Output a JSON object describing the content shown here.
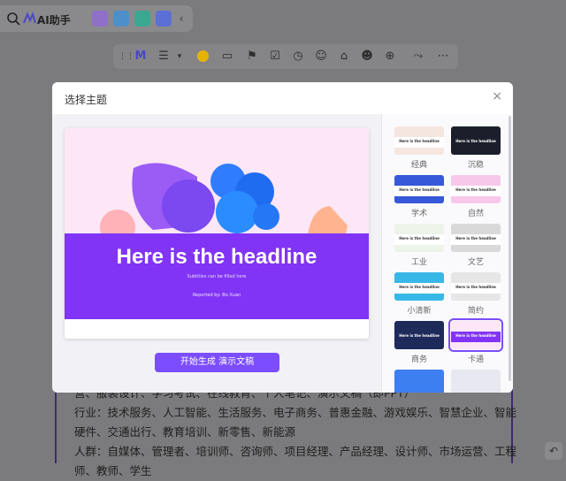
{
  "topbar": {
    "ai_label": "AI助手"
  },
  "modal": {
    "title": "选择主题",
    "close": "×",
    "preview": {
      "headline": "Here is the headline",
      "subtitle": "Subtitles can be filled here",
      "reporter": "Reported by:  Bo Xuan"
    },
    "generate_button": "开始生成 演示文稿",
    "themes": [
      {
        "label": "经典",
        "thumb_text": "Here is the headline",
        "bg": "#f5e6e0",
        "band": "#ffffff",
        "color": "#333333"
      },
      {
        "label": "沉稳",
        "thumb_text": "Here is the headline",
        "bg": "#1c1f2b",
        "band": "#1c1f2b",
        "color": "#ffffff"
      },
      {
        "label": "学术",
        "thumb_text": "Here is the headline",
        "bg": "#3658d9",
        "band": "#ffffff",
        "color": "#333333"
      },
      {
        "label": "自然",
        "thumb_text": "Here is the headline",
        "bg": "#f7c8ea",
        "band": "#ffffff",
        "color": "#333333"
      },
      {
        "label": "工业",
        "thumb_text": "Here is the headline",
        "bg": "#eef3ea",
        "band": "#ffffff",
        "color": "#333333"
      },
      {
        "label": "文艺",
        "thumb_text": "Here is the headline",
        "bg": "#d9d9d9",
        "band": "#ffffff",
        "color": "#333333"
      },
      {
        "label": "小清新",
        "thumb_text": "Here is the headline",
        "bg": "#38b8e6",
        "band": "#ffffff",
        "color": "#333333"
      },
      {
        "label": "简约",
        "thumb_text": "Here is the headline",
        "bg": "#e6e6e6",
        "band": "#ffffff",
        "color": "#333333"
      },
      {
        "label": "商务",
        "thumb_text": "Here is the headline",
        "bg": "#1e2a5a",
        "band": "#1e2a5a",
        "color": "#ffffff"
      },
      {
        "label": "卡通",
        "thumb_text": "Here is the headline",
        "bg": "#fde7f7",
        "band": "#8134f5",
        "color": "#ffffff"
      }
    ]
  },
  "doc": {
    "lines": [
      "营、服装设计、学习考试、在线教育、个人笔记、演示文稿（即PPT）",
      "行业：技术服务、人工智能、生活服务、电子商务、普惠金融、游戏娱乐、智慧企业、智能",
      "硬件、交通出行、教育培训、新零售、新能源",
      "人群：自媒体、管理者、培训师、咨询师、项目经理、产品经理、设计师、市场运营、工程",
      "师、教师、学生"
    ]
  },
  "colors": {
    "accent": "#7c4dff",
    "band": "#8134f5"
  }
}
